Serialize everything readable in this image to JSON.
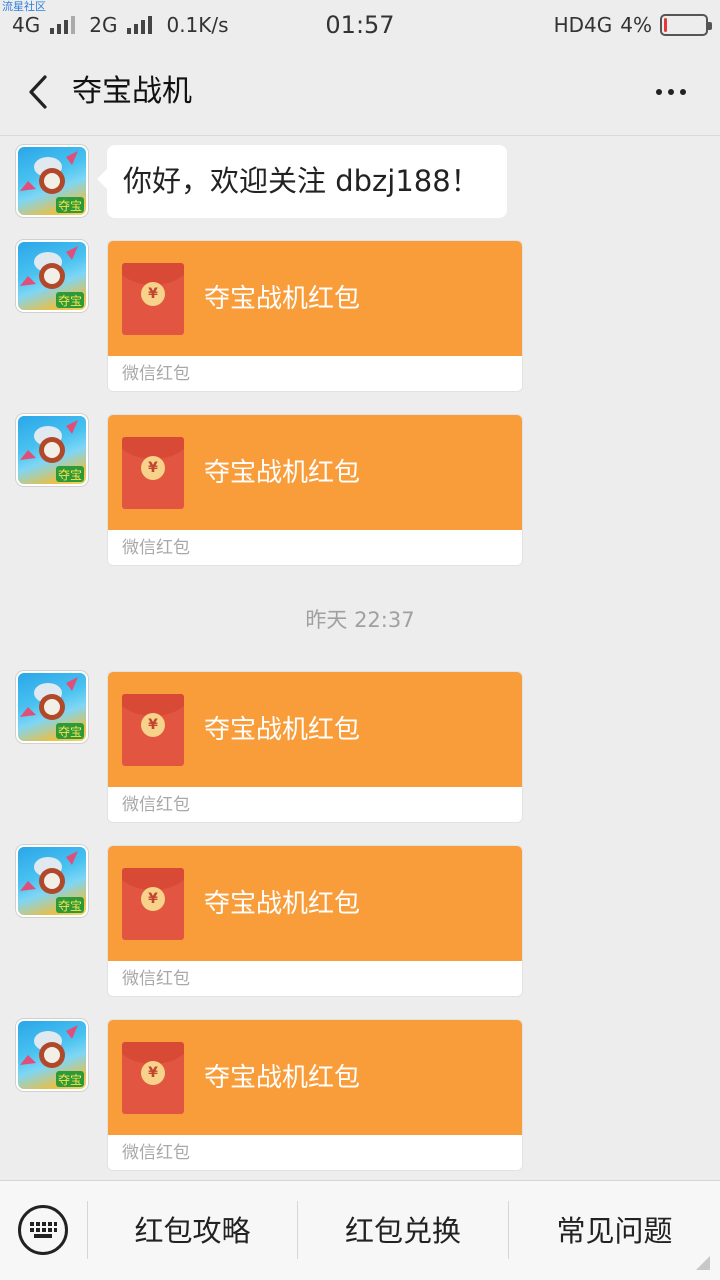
{
  "watermark": "流星社区",
  "status_bar": {
    "net1": "4G",
    "net2": "2G",
    "speed": "0.1K/s",
    "time": "01:57",
    "hd": "HD",
    "net3": "4G",
    "battery_text": "4%",
    "battery_level_percent": 4,
    "battery_color": "#e53935"
  },
  "nav": {
    "title": "夺宝战机",
    "back_icon": "chevron-left-icon",
    "more_icon": "more-dots-icon"
  },
  "messages": {
    "greeting": "你好，欢迎关注 dbzj188！",
    "timestamp": "昨天 22:37",
    "red_packets": [
      {
        "title": "夺宝战机红包",
        "footer": "微信红包",
        "coin": "¥"
      },
      {
        "title": "夺宝战机红包",
        "footer": "微信红包",
        "coin": "¥"
      },
      {
        "title": "夺宝战机红包",
        "footer": "微信红包",
        "coin": "¥"
      },
      {
        "title": "夺宝战机红包",
        "footer": "微信红包",
        "coin": "¥"
      },
      {
        "title": "夺宝战机红包",
        "footer": "微信红包",
        "coin": "¥"
      }
    ],
    "avatar_label": "夺宝"
  },
  "bottom_menu": {
    "keyboard_icon": "keyboard-icon",
    "items": [
      "红包攻略",
      "红包兑换",
      "常见问题"
    ]
  },
  "colors": {
    "packet_orange": "#f99d3a",
    "packet_red": "#e25540",
    "background": "#ededed"
  }
}
